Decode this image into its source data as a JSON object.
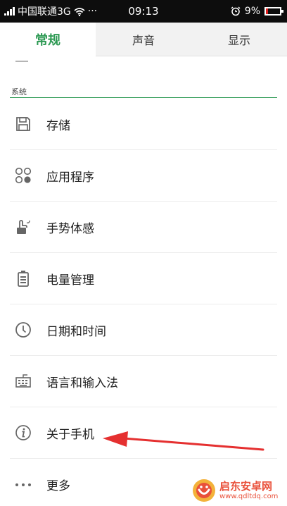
{
  "status_bar": {
    "carrier": "中国联通3G",
    "more": "···",
    "time": "09:13",
    "battery": "9%",
    "battery_level": 0.09
  },
  "tabs": [
    {
      "label": "常规",
      "active": true
    },
    {
      "label": "声音",
      "active": false
    },
    {
      "label": "显示",
      "active": false
    }
  ],
  "section": {
    "title": "系统"
  },
  "items": [
    {
      "label": "存储",
      "icon": "storage-icon"
    },
    {
      "label": "应用程序",
      "icon": "apps-icon"
    },
    {
      "label": "手势体感",
      "icon": "gesture-icon"
    },
    {
      "label": "电量管理",
      "icon": "battery-icon"
    },
    {
      "label": "日期和时间",
      "icon": "clock-icon"
    },
    {
      "label": "语言和输入法",
      "icon": "keyboard-icon"
    },
    {
      "label": "关于手机",
      "icon": "info-icon"
    },
    {
      "label": "更多",
      "icon": "more-icon"
    }
  ],
  "watermark": {
    "name": "启东安卓网",
    "url": "www.qdltdq.com"
  },
  "colors": {
    "accent": "#2e9a54",
    "annotation": "#e53030",
    "watermark": "#e9503a"
  }
}
